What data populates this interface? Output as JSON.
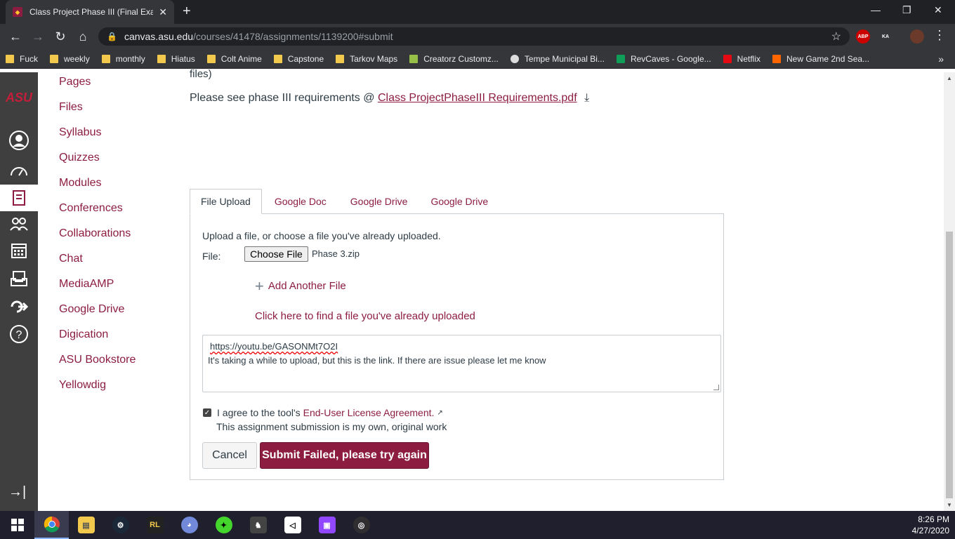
{
  "browser": {
    "tab_title": "Class Project Phase III (Final Exam",
    "url_domain": "canvas.asu.edu",
    "url_path": "/courses/41478/assignments/1139200#submit",
    "extensions": [
      "ABP",
      "KA"
    ],
    "bookmarks": [
      {
        "label": "Fuck",
        "color": "#f2c94c"
      },
      {
        "label": "weekly",
        "color": "#f2c94c"
      },
      {
        "label": "monthly",
        "color": "#f2c94c"
      },
      {
        "label": "Hiatus",
        "color": "#f2c94c"
      },
      {
        "label": "Colt Anime",
        "color": "#f2c94c"
      },
      {
        "label": "Capstone",
        "color": "#f2c94c"
      },
      {
        "label": "Tarkov Maps",
        "color": "#f2c94c"
      },
      {
        "label": "Creatorz Customz...",
        "color": "#95bf47"
      },
      {
        "label": "Tempe Municipal Bi...",
        "color": "#dddddd"
      },
      {
        "label": "RevCaves - Google...",
        "color": "#0f9d58"
      },
      {
        "label": "Netflix",
        "color": "#e50914"
      },
      {
        "label": "New Game 2nd Sea...",
        "color": "#ff6600"
      }
    ]
  },
  "global_nav": {
    "logo": "ASU"
  },
  "course_nav": [
    "Pages",
    "Files",
    "Syllabus",
    "Quizzes",
    "Modules",
    "Conferences",
    "Collaborations",
    "Chat",
    "MediaAMP",
    "Google Drive",
    "Digication",
    "ASU Bookstore",
    "Yellowdig"
  ],
  "main": {
    "cutoff_text": "files)",
    "requirements_prefix": "Please see phase III requirements @",
    "requirements_link": "Class ProjectPhaseIII Requirements.pdf",
    "tabs": [
      "File Upload",
      "Google Doc",
      "Google Drive",
      "Google Drive"
    ],
    "upload_intro": "Upload a file, or choose a file you've already uploaded.",
    "file_label": "File:",
    "choose_file_label": "Choose File",
    "chosen_file_name": "Phase 3.zip",
    "add_another_file": "Add Another File",
    "find_uploaded": "Click here to find a file you've already uploaded",
    "comment_line1": "https://youtu.be/GASONMt7O2I",
    "comment_line2": "It's taking a while to upload, but this is the link. If there are issue please let me know",
    "agree_prefix": "I agree to the tool's",
    "eula_link": "End-User License Agreement.",
    "own_work": "This assignment submission is my own, original work",
    "cancel_label": "Cancel",
    "submit_label": "Submit Failed, please try again"
  },
  "taskbar": {
    "time": "8:26 PM",
    "date": "4/27/2020"
  }
}
